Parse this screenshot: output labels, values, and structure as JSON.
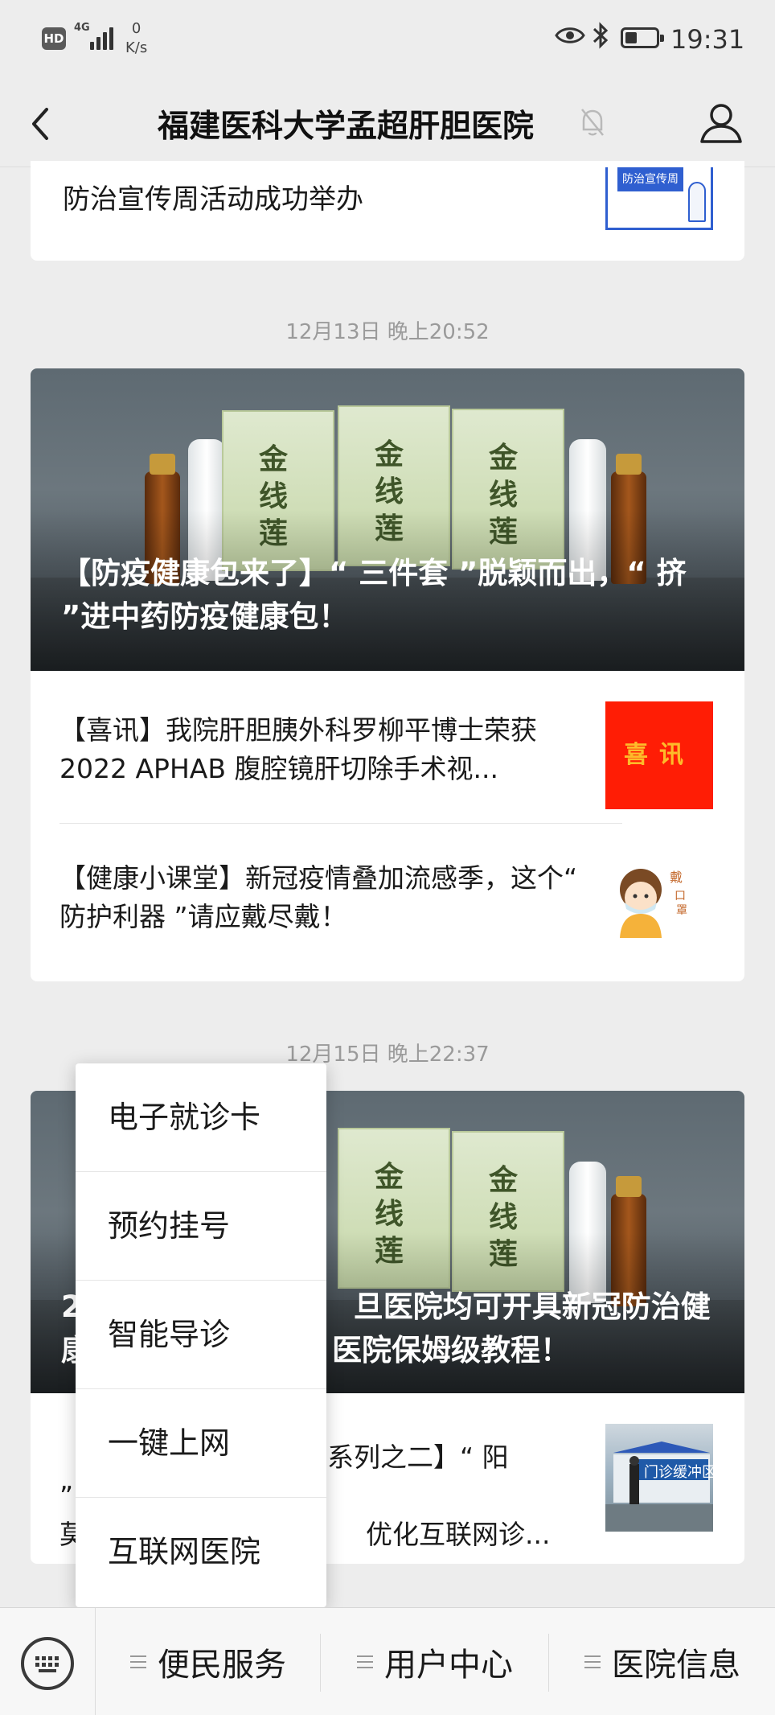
{
  "status_bar": {
    "hd": "HD",
    "network": "4G",
    "speed_value": "0",
    "speed_unit": "K/s",
    "time": "19:31"
  },
  "header": {
    "title": "福建医科大学孟超肝胆医院"
  },
  "feed": {
    "top_card": {
      "title": "防治宣传周活动成功举办",
      "thumb_text": "防治宣传周"
    },
    "groups": [
      {
        "timestamp": "12月13日 晚上20:52",
        "hero": {
          "title": "【防疫健康包来了】“ 三件套 ”脱颖而出，“ 挤 ”进中药防疫健康包！"
        },
        "items": [
          {
            "title": "【喜讯】我院肝胆胰外科罗柳平博士荣获 2022 APHAB 腹腔镜肝切除手术视...",
            "thumb_text": "喜讯"
          },
          {
            "title": "【健康小课堂】新冠疫情叠加流感季，这个“ 防护利器 ”请应戴尽戴！",
            "thumb_text": ""
          }
        ]
      },
      {
        "timestamp": "12月15日 晚上22:37",
        "hero": {
          "title_line1": "2",
          "title_line1_visible": "旦医院均可开具新冠防治健",
          "title_line2_a": "康",
          "title_line2_visible": "医院保姆级教程！"
        },
        "items": [
          {
            "title_a": "【",
            "title_b": "系列之二】“ 阳 ”了？",
            "title_c": "莫",
            "title_d": "优化互联网诊...",
            "thumb_text": "门诊缓冲区"
          }
        ]
      }
    ]
  },
  "menu": {
    "items": [
      {
        "label": "电子就诊卡"
      },
      {
        "label": "预约挂号"
      },
      {
        "label": "智能导诊"
      },
      {
        "label": "一键上网"
      },
      {
        "label": "互联网医院"
      }
    ]
  },
  "bottom_bar": {
    "tabs": [
      {
        "label": "便民服务"
      },
      {
        "label": "用户中心"
      },
      {
        "label": "医院信息"
      }
    ]
  },
  "icons": {
    "back": "chevron-left-icon",
    "mute": "bell-off-icon",
    "profile": "person-icon",
    "keyboard": "keyboard-icon",
    "eye": "eye-icon",
    "bluetooth": "bluetooth-icon",
    "battery": "battery-icon"
  },
  "colors": {
    "background": "#ededed",
    "card": "#ffffff",
    "timestamp": "#9a9a9a",
    "thumb_red": "#ff1d05",
    "thumb_blue": "#2f5fd0"
  }
}
